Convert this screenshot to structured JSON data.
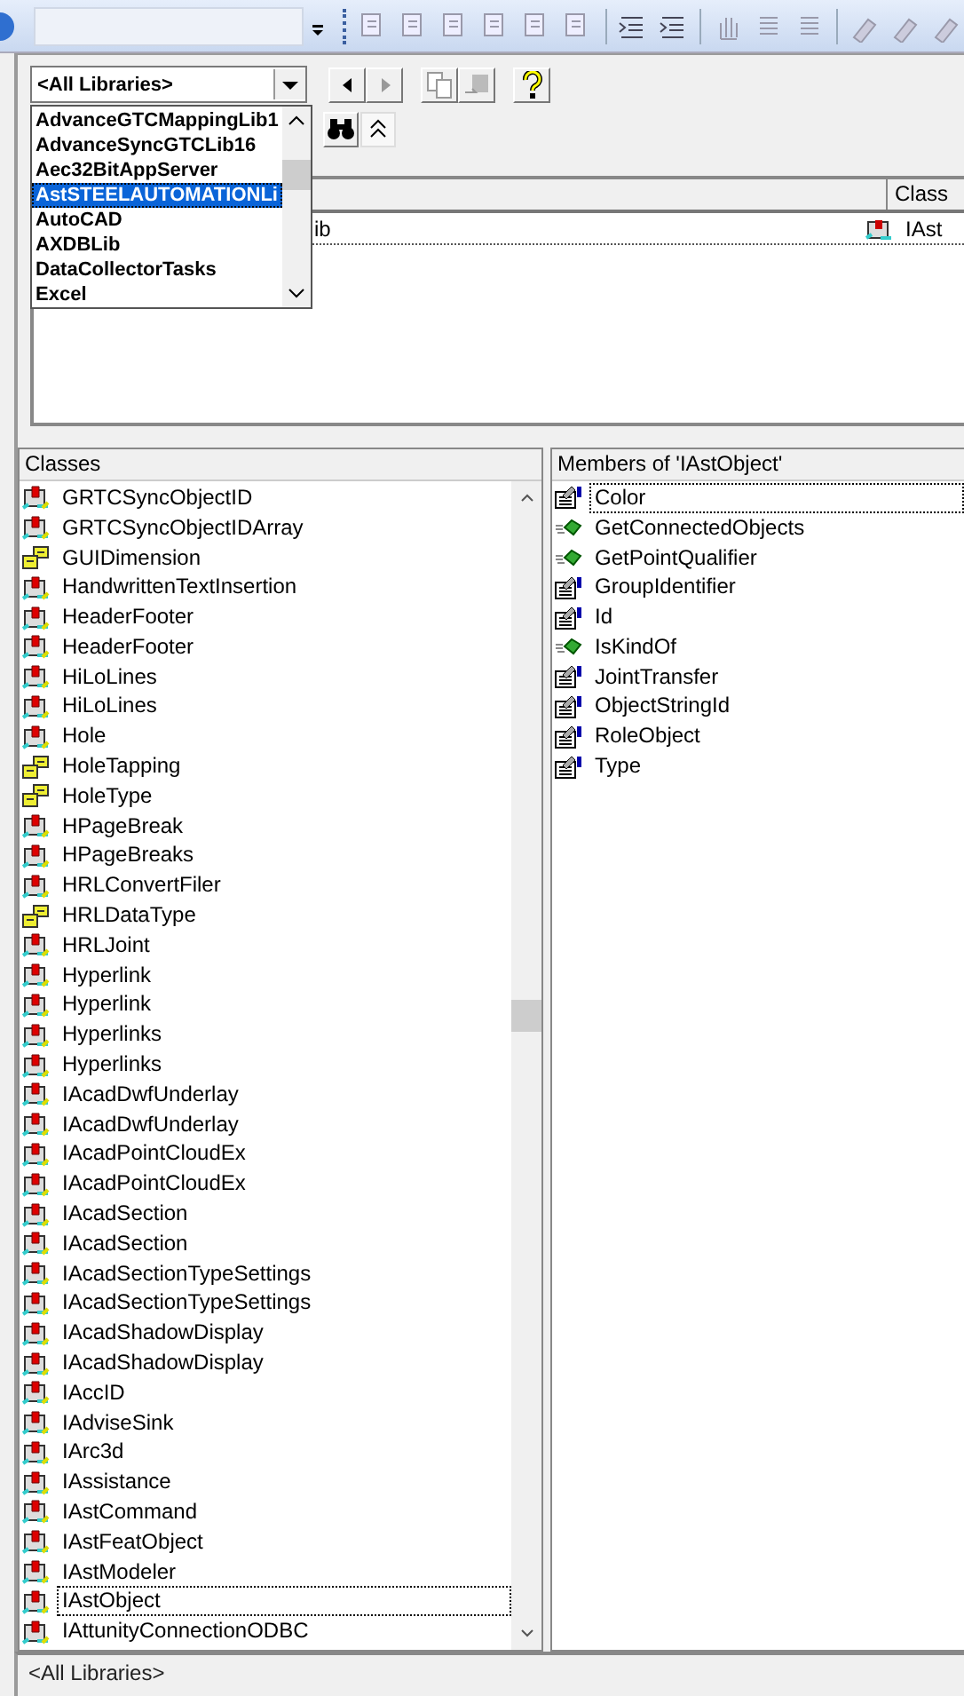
{
  "library_dropdown": {
    "value": "<All Libraries>",
    "expanded": true,
    "options": [
      {
        "label": "AdvanceGTCMappingLib1",
        "selected": false
      },
      {
        "label": "AdvanceSyncGTCLib16",
        "selected": false
      },
      {
        "label": "Aec32BitAppServer",
        "selected": false
      },
      {
        "label": "AstSTEELAUTOMATIONLi",
        "selected": true
      },
      {
        "label": "AutoCAD",
        "selected": false
      },
      {
        "label": "AXDBLib",
        "selected": false
      },
      {
        "label": "DataCollectorTasks",
        "selected": false
      },
      {
        "label": "Excel",
        "selected": false
      }
    ]
  },
  "search_results": {
    "columns": [
      {
        "label": "Class"
      }
    ],
    "rows": [
      {
        "library": "ib",
        "class": "IAst"
      }
    ]
  },
  "classes": {
    "title": "Classes",
    "items": [
      {
        "label": "GRTCSyncObjectID",
        "kind": "class",
        "selected": false
      },
      {
        "label": "GRTCSyncObjectIDArray",
        "kind": "class",
        "selected": false
      },
      {
        "label": "GUIDimension",
        "kind": "enum",
        "selected": false
      },
      {
        "label": "HandwrittenTextInsertion",
        "kind": "class",
        "selected": false
      },
      {
        "label": "HeaderFooter",
        "kind": "class",
        "selected": false
      },
      {
        "label": "HeaderFooter",
        "kind": "class",
        "selected": false
      },
      {
        "label": "HiLoLines",
        "kind": "class",
        "selected": false
      },
      {
        "label": "HiLoLines",
        "kind": "class",
        "selected": false
      },
      {
        "label": "Hole",
        "kind": "class",
        "selected": false
      },
      {
        "label": "HoleTapping",
        "kind": "enum",
        "selected": false
      },
      {
        "label": "HoleType",
        "kind": "enum",
        "selected": false
      },
      {
        "label": "HPageBreak",
        "kind": "class",
        "selected": false
      },
      {
        "label": "HPageBreaks",
        "kind": "class",
        "selected": false
      },
      {
        "label": "HRLConvertFiler",
        "kind": "class",
        "selected": false
      },
      {
        "label": "HRLDataType",
        "kind": "enum",
        "selected": false
      },
      {
        "label": "HRLJoint",
        "kind": "class",
        "selected": false
      },
      {
        "label": "Hyperlink",
        "kind": "class",
        "selected": false
      },
      {
        "label": "Hyperlink",
        "kind": "class",
        "selected": false
      },
      {
        "label": "Hyperlinks",
        "kind": "class",
        "selected": false
      },
      {
        "label": "Hyperlinks",
        "kind": "class",
        "selected": false
      },
      {
        "label": "IAcadDwfUnderlay",
        "kind": "class",
        "selected": false
      },
      {
        "label": "IAcadDwfUnderlay",
        "kind": "class",
        "selected": false
      },
      {
        "label": "IAcadPointCloudEx",
        "kind": "class",
        "selected": false
      },
      {
        "label": "IAcadPointCloudEx",
        "kind": "class",
        "selected": false
      },
      {
        "label": "IAcadSection",
        "kind": "class",
        "selected": false
      },
      {
        "label": "IAcadSection",
        "kind": "class",
        "selected": false
      },
      {
        "label": "IAcadSectionTypeSettings",
        "kind": "class",
        "selected": false
      },
      {
        "label": "IAcadSectionTypeSettings",
        "kind": "class",
        "selected": false
      },
      {
        "label": "IAcadShadowDisplay",
        "kind": "class",
        "selected": false
      },
      {
        "label": "IAcadShadowDisplay",
        "kind": "class",
        "selected": false
      },
      {
        "label": "IAccID",
        "kind": "class",
        "selected": false
      },
      {
        "label": "IAdviseSink",
        "kind": "class",
        "selected": false
      },
      {
        "label": "IArc3d",
        "kind": "class",
        "selected": false
      },
      {
        "label": "IAssistance",
        "kind": "class",
        "selected": false
      },
      {
        "label": "IAstCommand",
        "kind": "class",
        "selected": false
      },
      {
        "label": "IAstFeatObject",
        "kind": "class",
        "selected": false
      },
      {
        "label": "IAstModeler",
        "kind": "class",
        "selected": false
      },
      {
        "label": "IAstObject",
        "kind": "class",
        "selected": true
      },
      {
        "label": "IAttunityConnectionODBC",
        "kind": "class",
        "selected": false
      }
    ]
  },
  "members": {
    "title": "Members of 'IAstObject'",
    "items": [
      {
        "label": "Color",
        "kind": "property",
        "selected": true
      },
      {
        "label": "GetConnectedObjects",
        "kind": "method",
        "selected": false
      },
      {
        "label": "GetPointQualifier",
        "kind": "method",
        "selected": false
      },
      {
        "label": "GroupIdentifier",
        "kind": "property",
        "selected": false
      },
      {
        "label": "Id",
        "kind": "property",
        "selected": false
      },
      {
        "label": "IsKindOf",
        "kind": "method",
        "selected": false
      },
      {
        "label": "JointTransfer",
        "kind": "property",
        "selected": false
      },
      {
        "label": "ObjectStringId",
        "kind": "property",
        "selected": false
      },
      {
        "label": "RoleObject",
        "kind": "property",
        "selected": false
      },
      {
        "label": "Type",
        "kind": "property",
        "selected": false
      }
    ]
  },
  "status_bar": {
    "text": "<All Libraries>"
  }
}
